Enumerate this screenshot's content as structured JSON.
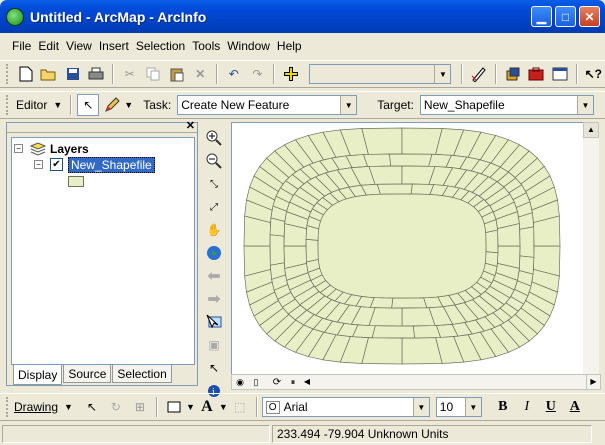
{
  "window": {
    "title": "Untitled - ArcMap - ArcInfo"
  },
  "menu": [
    "File",
    "Edit",
    "View",
    "Insert",
    "Selection",
    "Tools",
    "Window",
    "Help"
  ],
  "editor": {
    "label": "Editor",
    "task_label": "Task:",
    "task_value": "Create New Feature",
    "target_label": "Target:",
    "target_value": "New_Shapefile"
  },
  "toc": {
    "root": "Layers",
    "layer": "New_Shapefile",
    "tabs": [
      "Display",
      "Source",
      "Selection"
    ]
  },
  "drawing": {
    "label": "Drawing",
    "font": "Arial",
    "size": "10",
    "bold": "B",
    "italic": "I",
    "underline": "U"
  },
  "status": {
    "coords": "233.494  -79.904 Unknown Units"
  },
  "colors": {
    "polygon_fill": "#e8efc6",
    "polygon_stroke": "#6f6f5f",
    "titlebar": "#0054e3"
  }
}
